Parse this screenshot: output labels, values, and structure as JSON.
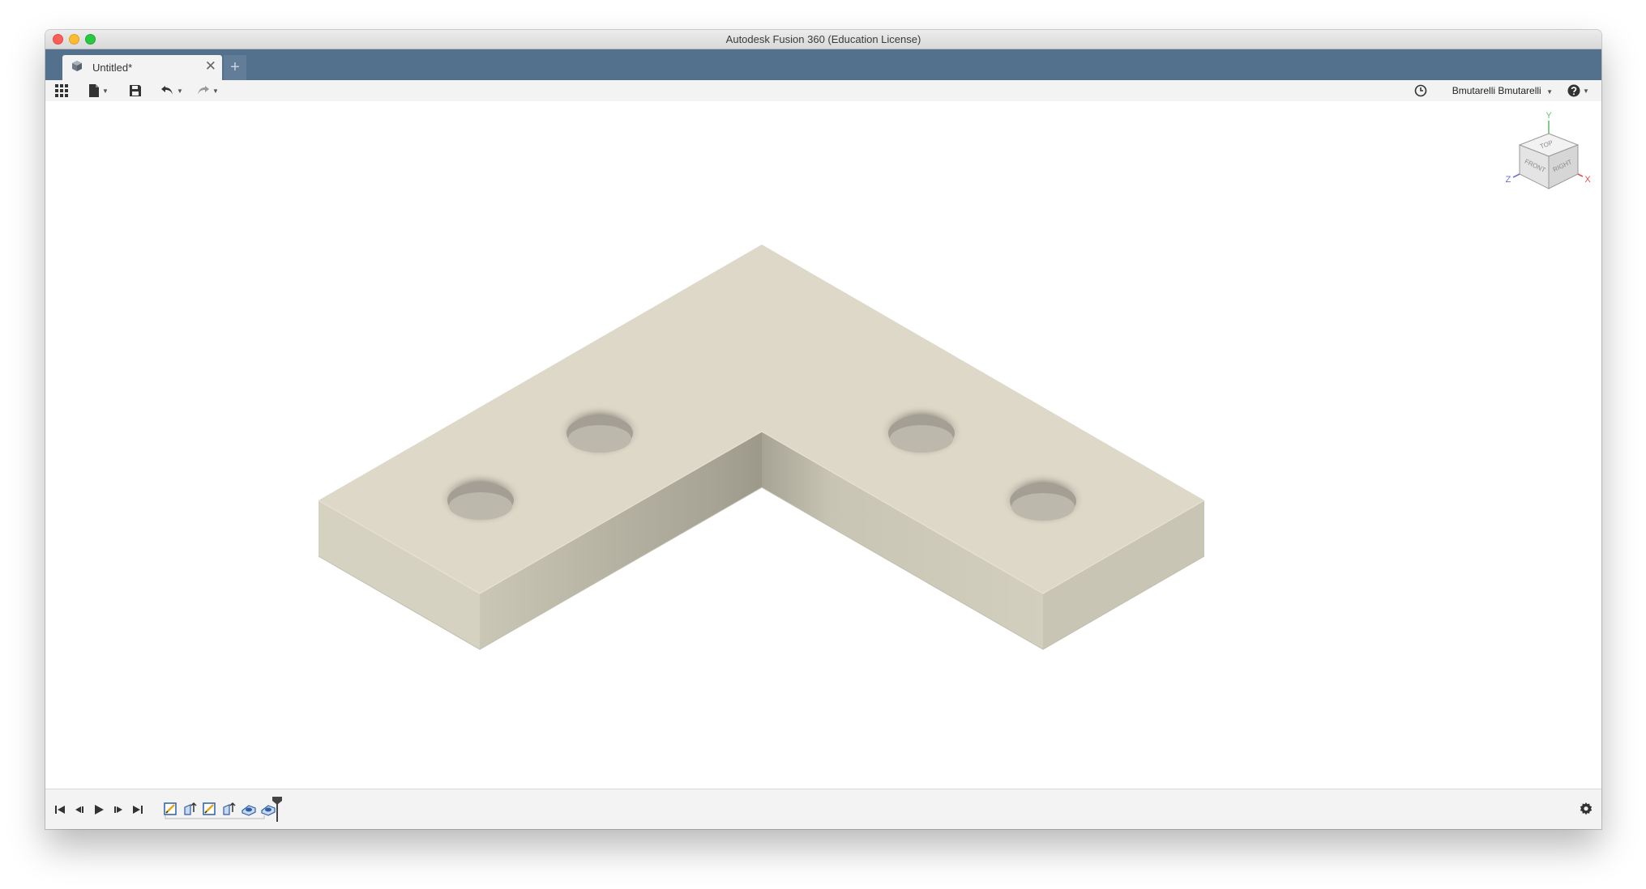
{
  "window": {
    "title": "Autodesk Fusion 360 (Education License)"
  },
  "tabs": [
    {
      "label": "Untitled*",
      "close": "✕"
    }
  ],
  "new_tab": "+",
  "toolbar": {
    "user_name": "Bmutarelli Bmutarelli"
  },
  "viewcube": {
    "faces": {
      "top": "TOP",
      "front": "FRONT",
      "right": "RIGHT"
    },
    "axes": {
      "x": "X",
      "y": "Y",
      "z": "Z"
    },
    "axis_colors": {
      "x": "#e0504a",
      "y": "#62c36e",
      "z": "#6672d6"
    }
  },
  "model": {
    "description_color": "#ddd8c8",
    "hole_count": 4
  },
  "timeline": {
    "features": [
      {
        "icon": "sketch-icon"
      },
      {
        "icon": "extrude-icon"
      },
      {
        "icon": "sketch-icon"
      },
      {
        "icon": "extrude-icon"
      },
      {
        "icon": "hole-icon"
      },
      {
        "icon": "hole-icon"
      }
    ]
  }
}
